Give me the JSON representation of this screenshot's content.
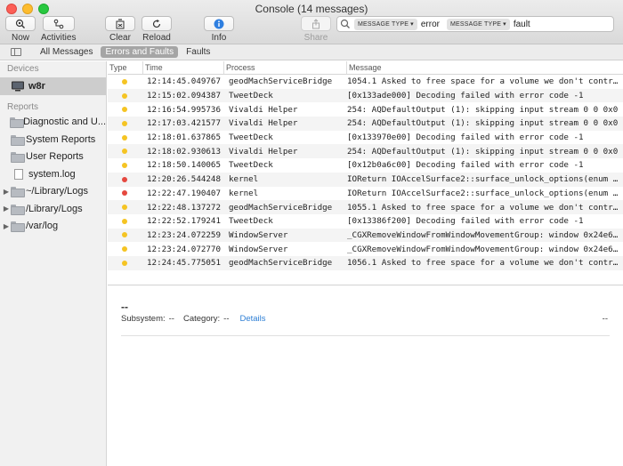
{
  "window": {
    "title": "Console (14 messages)"
  },
  "toolbar": {
    "now": "Now",
    "activities": "Activities",
    "clear": "Clear",
    "reload": "Reload",
    "info": "Info",
    "share": "Share"
  },
  "search": {
    "tokens": [
      {
        "label": "MESSAGE TYPE",
        "value": "error"
      },
      {
        "label": "MESSAGE TYPE",
        "value": "fault"
      }
    ]
  },
  "filters": [
    "All Messages",
    "Errors and Faults",
    "Faults"
  ],
  "selected_filter": "Errors and Faults",
  "sidebar": {
    "devices_header": "Devices",
    "device": "w8r",
    "reports_header": "Reports",
    "items": [
      {
        "label": "Diagnostic and U...",
        "type": "folder",
        "expandable": false
      },
      {
        "label": "System Reports",
        "type": "folder",
        "expandable": false
      },
      {
        "label": "User Reports",
        "type": "folder",
        "expandable": false
      },
      {
        "label": "system.log",
        "type": "file",
        "expandable": false
      },
      {
        "label": "~/Library/Logs",
        "type": "folder",
        "expandable": true
      },
      {
        "label": "/Library/Logs",
        "type": "folder",
        "expandable": true
      },
      {
        "label": "/var/log",
        "type": "folder",
        "expandable": true
      }
    ]
  },
  "table": {
    "headers": [
      "Type",
      "Time",
      "Process",
      "Message"
    ],
    "type_colors": {
      "error": "#f5c423",
      "fault": "#e5483f"
    },
    "rows": [
      {
        "type": "error",
        "time": "12:14:45.049767",
        "process": "geodMachServiceBridge",
        "message": "1054.1 Asked to free space for a volume we don't contro…"
      },
      {
        "type": "error",
        "time": "12:15:02.094387",
        "process": "TweetDeck",
        "message": "[0x133ade000] Decoding failed with error code -1"
      },
      {
        "type": "error",
        "time": "12:16:54.995736",
        "process": "Vivaldi Helper",
        "message": "254: AQDefaultOutput (1): skipping input stream 0 0 0x0"
      },
      {
        "type": "error",
        "time": "12:17:03.421577",
        "process": "Vivaldi Helper",
        "message": "254: AQDefaultOutput (1): skipping input stream 0 0 0x0"
      },
      {
        "type": "error",
        "time": "12:18:01.637865",
        "process": "TweetDeck",
        "message": "[0x133970e00] Decoding failed with error code -1"
      },
      {
        "type": "error",
        "time": "12:18:02.930613",
        "process": "Vivaldi Helper",
        "message": "254: AQDefaultOutput (1): skipping input stream 0 0 0x0"
      },
      {
        "type": "error",
        "time": "12:18:50.140065",
        "process": "TweetDeck",
        "message": "[0x12b0a6c00] Decoding failed with error code -1"
      },
      {
        "type": "fault",
        "time": "12:20:26.544248",
        "process": "kernel",
        "message": "IOReturn IOAccelSurface2::surface_unlock_options(enum e…"
      },
      {
        "type": "fault",
        "time": "12:22:47.190407",
        "process": "kernel",
        "message": "IOReturn IOAccelSurface2::surface_unlock_options(enum e…"
      },
      {
        "type": "error",
        "time": "12:22:48.137272",
        "process": "geodMachServiceBridge",
        "message": "1055.1 Asked to free space for a volume we don't contro…"
      },
      {
        "type": "error",
        "time": "12:22:52.179241",
        "process": "TweetDeck",
        "message": "[0x13386f200] Decoding failed with error code -1"
      },
      {
        "type": "error",
        "time": "12:23:24.072259",
        "process": "WindowServer",
        "message": "_CGXRemoveWindowFromWindowMovementGroup: window 0x24e6…"
      },
      {
        "type": "error",
        "time": "12:23:24.072770",
        "process": "WindowServer",
        "message": "_CGXRemoveWindowFromWindowMovementGroup: window 0x24e6…"
      },
      {
        "type": "error",
        "time": "12:24:45.775051",
        "process": "geodMachServiceBridge",
        "message": "1056.1 Asked to free space for a volume we don't contro…"
      }
    ]
  },
  "detail": {
    "title": "--",
    "subsystem_label": "Subsystem:",
    "subsystem_value": "--",
    "category_label": "Category:",
    "category_value": "--",
    "details_link": "Details",
    "right_value": "--"
  }
}
